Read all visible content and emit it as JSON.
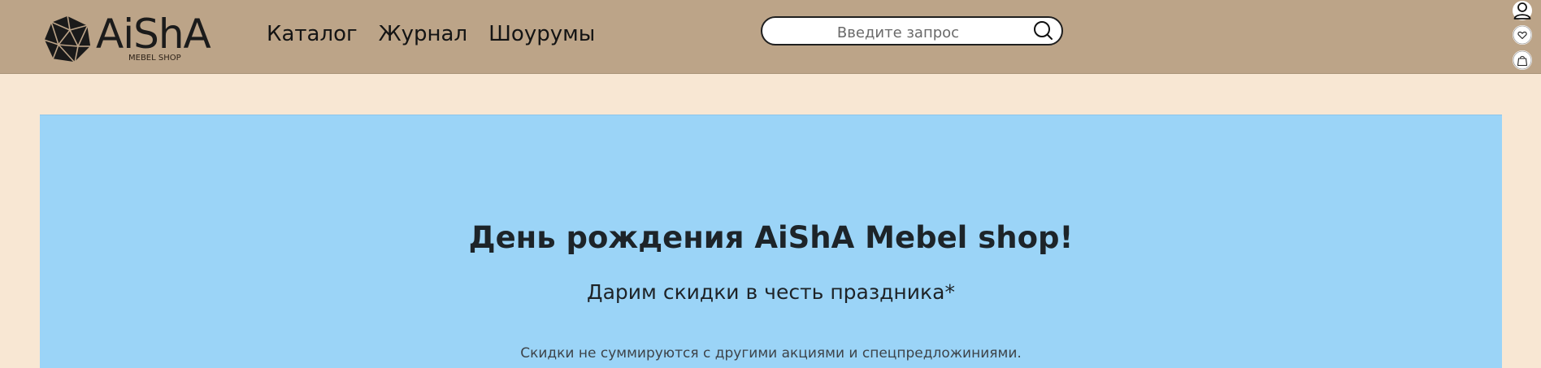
{
  "colors": {
    "header_bg": "#bca488",
    "page_bg": "#f8e7d3",
    "promo_bg": "#9bd4f7",
    "text_dark": "#1d2429"
  },
  "header": {
    "logo": {
      "name": "AiShA",
      "subtitle": "MEBEL SHOP",
      "icon": "polyhedron-logo-icon"
    },
    "nav": [
      {
        "label": "Каталог"
      },
      {
        "label": "Журнал"
      },
      {
        "label": "Шоурумы"
      }
    ],
    "search": {
      "placeholder": "Введите запрос",
      "icon": "search-icon"
    },
    "icons": [
      {
        "name": "user-icon"
      },
      {
        "name": "heart-icon"
      },
      {
        "name": "shopping-bag-icon"
      }
    ]
  },
  "promo": {
    "title": "День рождения AiShA Mebel shop!",
    "subtitle": "Дарим скидки в честь праздника*",
    "note": "Скидки не суммируются с другими акциями и спецпредложиниями."
  }
}
